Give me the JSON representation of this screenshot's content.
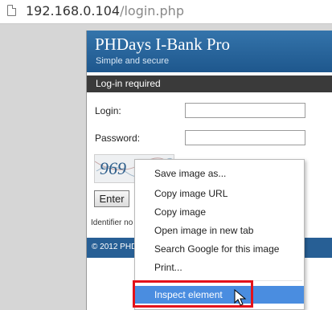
{
  "browser": {
    "url_host": "192.168.0.104",
    "url_path": "/login.php"
  },
  "app": {
    "title": "PHDays I-Bank Pro",
    "subtitle": "Simple and secure",
    "section_title": "Log-in required",
    "login_label": "Login:",
    "password_label": "Password:",
    "enter_button": "Enter",
    "identifier_text": "Identifier no",
    "footer_text": "© 2012 PHD"
  },
  "captcha": {
    "text": "969"
  },
  "context_menu": {
    "items": [
      {
        "label": "Save image as..."
      },
      {
        "label": "Copy image URL"
      },
      {
        "label": "Copy image"
      },
      {
        "label": "Open image in new tab"
      },
      {
        "label": "Search Google for this image"
      },
      {
        "label": "Print..."
      },
      {
        "label": "Inspect element"
      }
    ],
    "highlighted_index": 6
  },
  "colors": {
    "header_blue": "#2a66a0",
    "highlight": "#4a8de0",
    "annotation_red": "#e3121a"
  }
}
